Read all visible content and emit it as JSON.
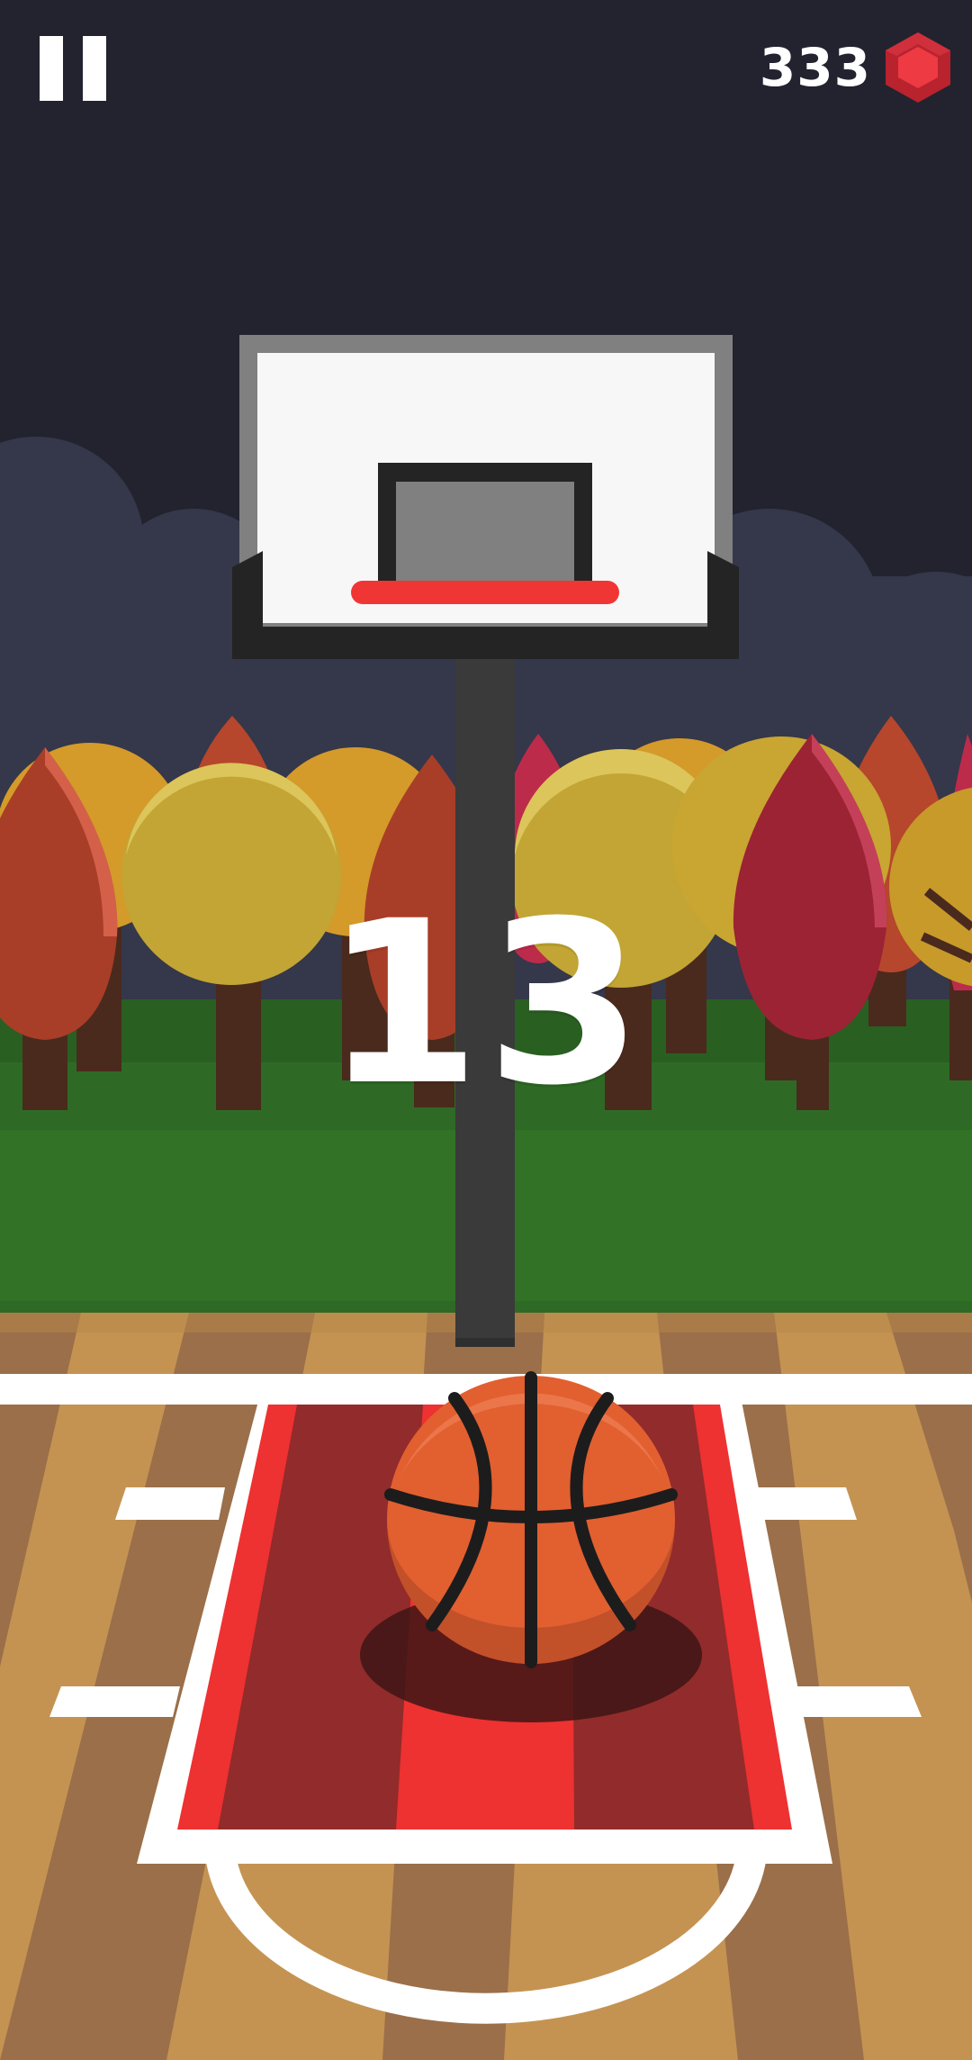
{
  "hud": {
    "pause_icon": "pause-icon",
    "gem_count": "333",
    "gem_icon": "red-hexagon-gem-icon"
  },
  "game": {
    "score": "13"
  },
  "colors": {
    "sky": "#22232f",
    "clouds": "#35374a",
    "grass": "#317227",
    "court_wood": "#c49352",
    "paint_red": "#ee3131",
    "ball_orange": "#e25f30",
    "gem_red": "#e8363f"
  }
}
